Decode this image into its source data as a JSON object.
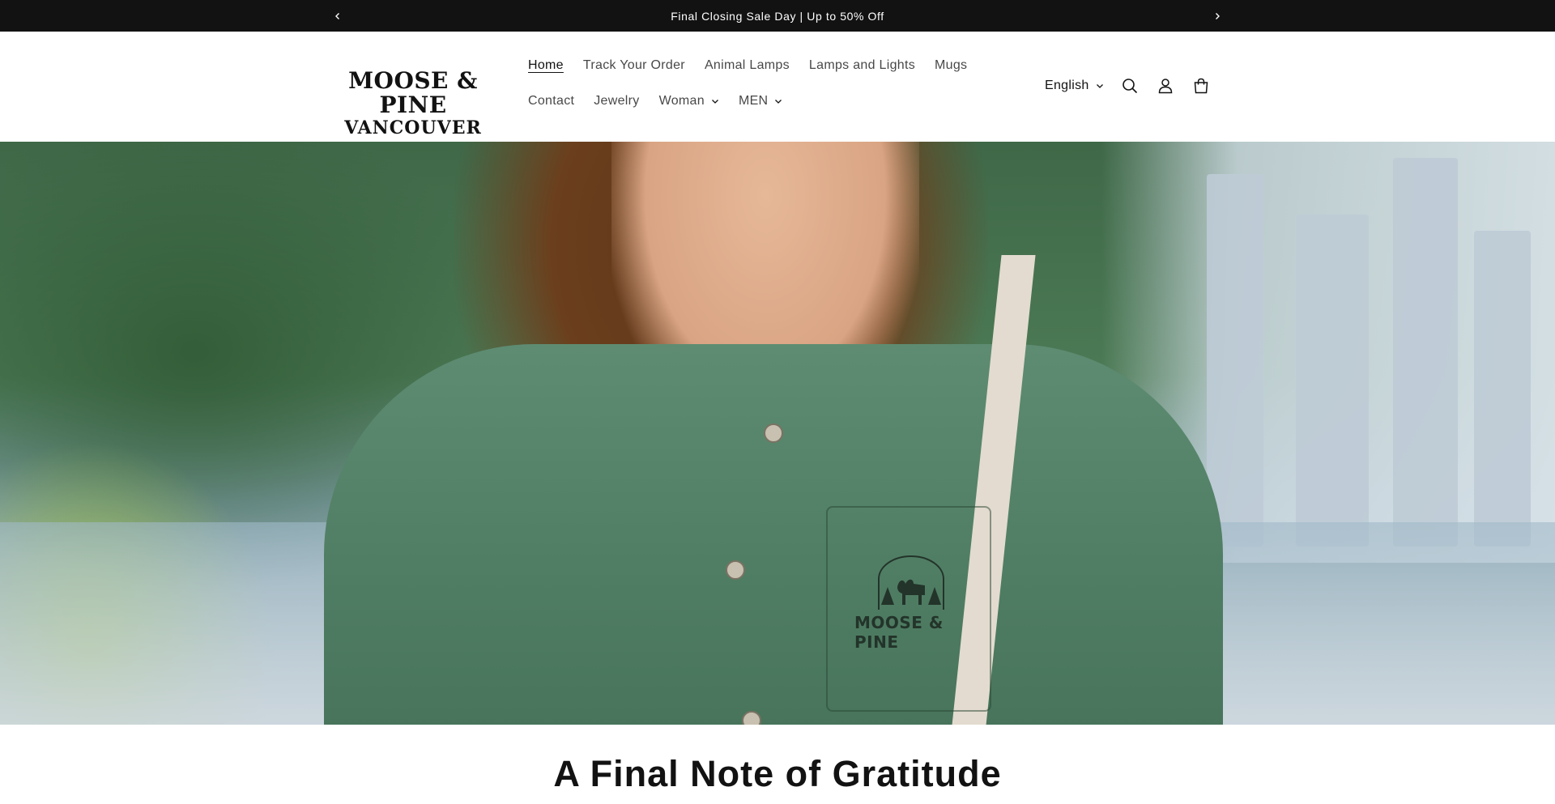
{
  "announcement": {
    "text": "Final Closing Sale Day | Up to 50% Off",
    "prev_icon": "chevron-left-icon",
    "next_icon": "chevron-right-icon"
  },
  "header": {
    "logo": {
      "line1": "MOOSE & PINE",
      "line2": "VANCOUVER"
    },
    "nav_row1": [
      {
        "label": "Home",
        "active": true
      },
      {
        "label": "Track Your Order"
      },
      {
        "label": "Animal Lamps"
      },
      {
        "label": "Lamps and Lights"
      },
      {
        "label": "Mugs"
      }
    ],
    "nav_row2": [
      {
        "label": "Contact"
      },
      {
        "label": "Jewelry"
      },
      {
        "label": "Woman",
        "has_dropdown": true
      },
      {
        "label": "MEN",
        "has_dropdown": true
      }
    ],
    "language": "English",
    "icons": [
      "search-icon",
      "account-icon",
      "cart-icon"
    ]
  },
  "hero": {
    "shirt_logo_text": "MOOSE & PINE"
  },
  "section": {
    "heading": "A Final Note of Gratitude"
  },
  "colors": {
    "announcement_bg": "#121212",
    "text": "#121212",
    "shirt_green": "#4e7c62"
  }
}
